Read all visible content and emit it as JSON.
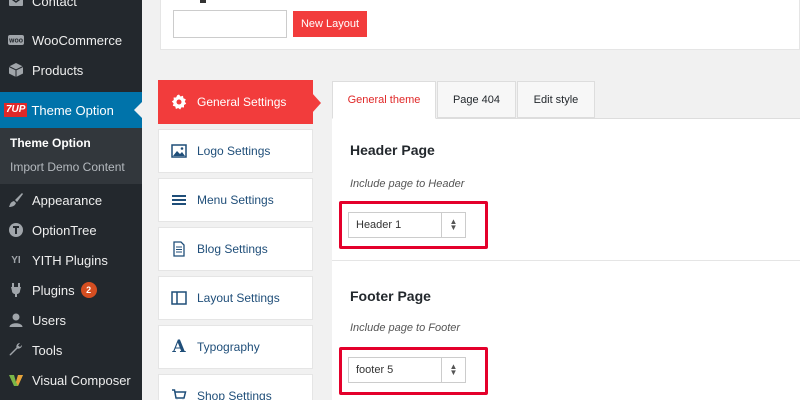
{
  "wp_sidebar": {
    "items": [
      {
        "label": "Contact",
        "icon": "mail-icon"
      },
      {
        "label": "WooCommerce",
        "icon": "woocommerce-icon"
      },
      {
        "label": "Products",
        "icon": "box-icon"
      },
      {
        "label": "Theme Option",
        "icon": "7up-logo-icon",
        "logo_text": "7UP",
        "active": true
      },
      {
        "label": "Appearance",
        "icon": "brush-icon"
      },
      {
        "label": "OptionTree",
        "icon": "tree-icon"
      },
      {
        "label": "YITH Plugins",
        "icon": "yith-icon",
        "logo_text": "YI"
      },
      {
        "label": "Plugins",
        "icon": "plug-icon",
        "badge": "2"
      },
      {
        "label": "Users",
        "icon": "user-icon"
      },
      {
        "label": "Tools",
        "icon": "wrench-icon"
      },
      {
        "label": "Visual Composer",
        "icon": "vc-icon"
      }
    ],
    "submenu": [
      {
        "label": "Theme Option",
        "current": true
      },
      {
        "label": "Import Demo Content",
        "current": false
      }
    ]
  },
  "layout_bar": {
    "input_value": "",
    "new_layout_label": "New Layout"
  },
  "options_menu": [
    {
      "label": "General Settings",
      "icon": "gear-icon",
      "active": true
    },
    {
      "label": "Logo Settings",
      "icon": "image-icon"
    },
    {
      "label": "Menu Settings",
      "icon": "list-icon"
    },
    {
      "label": "Blog Settings",
      "icon": "document-icon"
    },
    {
      "label": "Layout Settings",
      "icon": "columns-icon"
    },
    {
      "label": "Typography",
      "icon": "typography-icon",
      "icon_glyph": "A"
    },
    {
      "label": "Shop Settings",
      "icon": "cart-icon"
    }
  ],
  "tabs": [
    {
      "label": "General theme",
      "active": true
    },
    {
      "label": "Page 404"
    },
    {
      "label": "Edit style"
    }
  ],
  "sections": {
    "header": {
      "title": "Header Page",
      "description": "Include page to Header",
      "selected": "Header 1"
    },
    "footer": {
      "title": "Footer Page",
      "description": "Include page to Footer",
      "selected": "footer 5"
    }
  },
  "colors": {
    "accent_red": "#f23c3c",
    "highlight_red": "#e4002b",
    "wp_active_blue": "#0073aa",
    "wp_sidebar": "#23282d"
  }
}
